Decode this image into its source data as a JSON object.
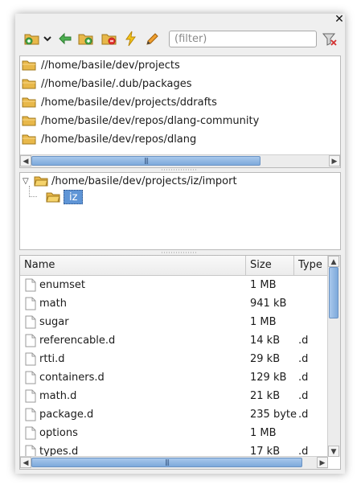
{
  "window": {
    "close_glyph": "✕"
  },
  "toolbar": {
    "buttons": [
      {
        "icon": "add-favorite-folder-icon"
      },
      {
        "icon": "dropdown-chevron-icon"
      },
      {
        "icon": "back-arrow-icon"
      },
      {
        "icon": "add-folder-icon"
      },
      {
        "icon": "remove-folder-icon"
      },
      {
        "icon": "flash-icon"
      },
      {
        "icon": "pencil-icon"
      }
    ],
    "filter_placeholder": "(filter)",
    "filter_value": "",
    "clear_icon": "clear-filter-icon"
  },
  "favorites": {
    "items": [
      {
        "label": "//home/basile/dev/projects"
      },
      {
        "label": "//home/basile/.dub/packages"
      },
      {
        "label": "/home/basile/dev/projects/ddrafts"
      },
      {
        "label": "/home/basile/dev/repos/dlang-community"
      },
      {
        "label": "/home/basile/dev/repos/dlang"
      }
    ]
  },
  "tree": {
    "root": "/home/basile/dev/projects/iz/import",
    "child": "iz"
  },
  "files": {
    "columns": [
      "Name",
      "Size",
      "Type"
    ],
    "rows": [
      {
        "name": "enumset",
        "size": "1 MB",
        "type": ""
      },
      {
        "name": "math",
        "size": "941 kB",
        "type": ""
      },
      {
        "name": "sugar",
        "size": "1 MB",
        "type": ""
      },
      {
        "name": "referencable.d",
        "size": "14 kB",
        "type": ".d"
      },
      {
        "name": "rtti.d",
        "size": "29 kB",
        "type": ".d"
      },
      {
        "name": "containers.d",
        "size": "129 kB",
        "type": ".d"
      },
      {
        "name": "math.d",
        "size": "21 kB",
        "type": ".d"
      },
      {
        "name": "package.d",
        "size": "235 byte",
        "type": ".d"
      },
      {
        "name": "options",
        "size": "1 MB",
        "type": ""
      },
      {
        "name": "types.d",
        "size": "17 kB",
        "type": ".d"
      }
    ]
  },
  "scrollbar_grip": "|||",
  "colors": {
    "folder": "#e8b84a",
    "selection": "#5f95d6",
    "scroll_thumb": "#7ea9db"
  }
}
